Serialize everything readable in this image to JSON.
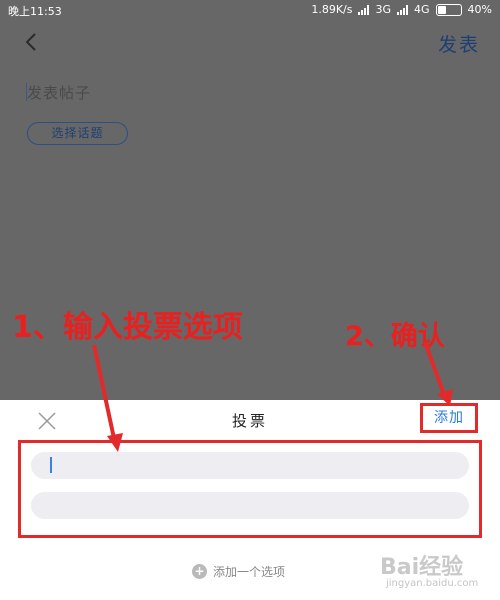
{
  "status_bar": {
    "time": "晚上11:53",
    "network_speed": "1.89K/s",
    "sim1": "3G",
    "sim2": "4G",
    "battery": "40%",
    "battery_level": 0.4
  },
  "header": {
    "back_icon": "chevron-left-icon",
    "publish_label": "发表"
  },
  "post": {
    "placeholder": "发表帖子",
    "topic_button": "选择话题"
  },
  "vote_sheet": {
    "close_icon": "close-icon",
    "title": "投票",
    "add_label": "添加",
    "options": [
      {
        "value": "",
        "placeholder": ""
      },
      {
        "value": "",
        "placeholder": ""
      }
    ],
    "add_option_label": "添加一个选项",
    "add_option_icon": "plus-circle-icon"
  },
  "annotations": {
    "step1": "1、输入投票选项",
    "step2": "2、确认"
  },
  "watermark": {
    "brand": "Bai经验",
    "site": "jingyan.baidu.com"
  },
  "colors": {
    "overlay": "#676767",
    "annotation_red": "#e32a2a",
    "link_blue": "#2d7be0",
    "publish_navy": "#1e3f73",
    "input_bg": "#eeeef2"
  }
}
